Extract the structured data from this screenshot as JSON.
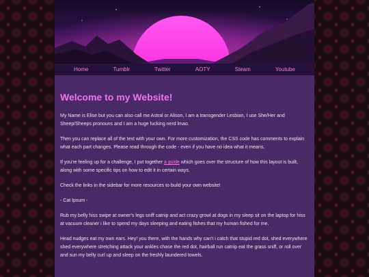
{
  "nav": {
    "items": [
      {
        "label": "Home"
      },
      {
        "label": "Tumblr"
      },
      {
        "label": "Twitter"
      },
      {
        "label": "AOTY"
      },
      {
        "label": "Steam"
      },
      {
        "label": "Youtube"
      }
    ]
  },
  "main": {
    "title": "Welcome to my Website!",
    "intro": "My Name is Elise but you can also call me Astral or Alison, I am a transgender Lesbian, I use She/Her and Sheep/Sheeps pronouns and I am a huge fucking nerd lmao.",
    "replace_text": "Then you can replace all of the text with your own. For more customization, the CSS code has comments to explain what each part changes. Please read through the code - even if you have no idea what it means.",
    "guide_before": "If you're feeling up for a challenge, I put together ",
    "guide_link": "a guide",
    "guide_after": " which goes over the structure of how this layout is built, along with some specific tips on how to edit it in certain ways.",
    "sidebar_note": "Check the links in the sidebar for more resources to build your own website!",
    "ipsum_heading": "- Cat Ipsum -",
    "ipsum_1": "Rub my belly hiss swipe at owner's legs sniff catnip and act crazy growl at dogs in my sleep sit on the laptop for hiss at vacuum cleaner i like to spend my days sleeping and eating fishes that my human fished for me.",
    "ipsum_2": "Head nudges eat my own ears. Hey! you there, with the hands why can't i catch that stupid red dot, shed everywhere shed everywhere stretching attack your ankles chase the red dot, hairball run catnip eat the grass sniff, or roll over and sun my belly curl up and sleep on the freshly laundered towels."
  },
  "colors": {
    "accent": "#ee74ee",
    "nav_link": "#f07ff0",
    "content_bg": "#4a2a66",
    "nav_bg": "#241038",
    "sun": "#ff30e0"
  }
}
